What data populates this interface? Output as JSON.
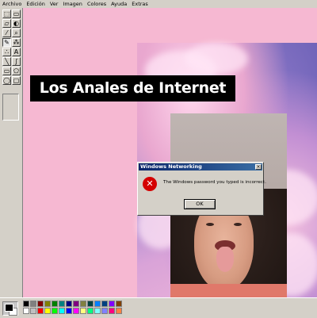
{
  "menu": {
    "items": [
      {
        "label": "Archivo"
      },
      {
        "label": "Edición"
      },
      {
        "label": "Ver"
      },
      {
        "label": "Imagen"
      },
      {
        "label": "Colores"
      },
      {
        "label": "Ayuda"
      },
      {
        "label": "Extras"
      }
    ]
  },
  "tools": [
    {
      "icon": "free-select-icon",
      "glyph": "⬚"
    },
    {
      "icon": "select-icon",
      "glyph": "▭"
    },
    {
      "icon": "eraser-icon",
      "glyph": "▱"
    },
    {
      "icon": "fill-icon",
      "glyph": "◐"
    },
    {
      "icon": "eyedropper-icon",
      "glyph": "⁄"
    },
    {
      "icon": "magnifier-icon",
      "glyph": "⌕"
    },
    {
      "icon": "pencil-icon",
      "glyph": "✎"
    },
    {
      "icon": "brush-icon",
      "glyph": "⁂"
    },
    {
      "icon": "airbrush-icon",
      "glyph": "∴"
    },
    {
      "icon": "text-icon",
      "glyph": "A"
    },
    {
      "icon": "line-icon",
      "glyph": "╲"
    },
    {
      "icon": "curve-icon",
      "glyph": "∫"
    },
    {
      "icon": "rectangle-icon",
      "glyph": "▭"
    },
    {
      "icon": "polygon-icon",
      "glyph": "⬠"
    },
    {
      "icon": "ellipse-icon",
      "glyph": "◯"
    },
    {
      "icon": "rounded-rect-icon",
      "glyph": "▢"
    }
  ],
  "canvas": {
    "title": "Los Anales de Internet"
  },
  "dialog": {
    "title": "Windows Networking",
    "message": "The Windows password you typed is incorrect.",
    "ok_label": "OK",
    "close_glyph": "×",
    "error_glyph": "✕"
  },
  "palette": {
    "foreground": "#000000",
    "background": "#ffffff",
    "colors": [
      "#000000",
      "#808080",
      "#800000",
      "#808000",
      "#008000",
      "#008080",
      "#000080",
      "#800080",
      "#808040",
      "#004040",
      "#0080ff",
      "#004080",
      "#8000ff",
      "#804000",
      "#ffffff",
      "#c0c0c0",
      "#ff0000",
      "#ffff00",
      "#00ff00",
      "#00ffff",
      "#0000ff",
      "#ff00ff",
      "#ffff80",
      "#00ff80",
      "#80ffff",
      "#8080ff",
      "#ff0080",
      "#ff8040"
    ]
  }
}
